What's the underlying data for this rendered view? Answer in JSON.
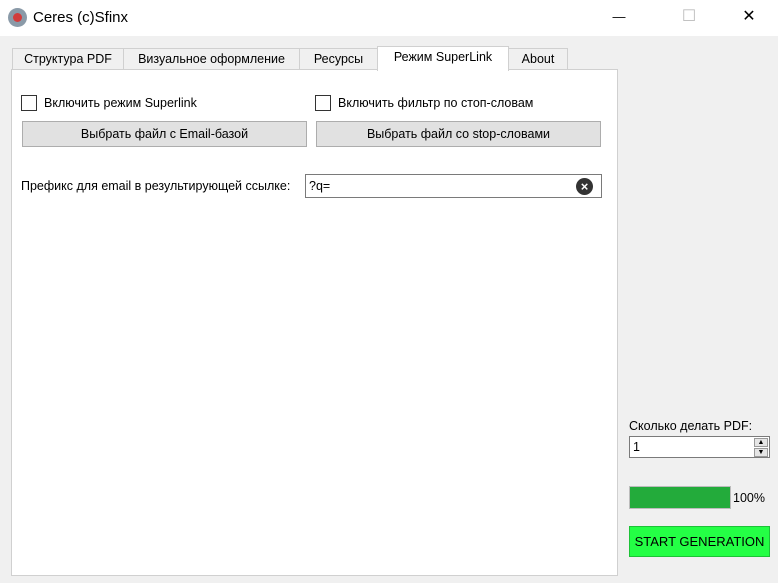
{
  "window": {
    "title": "Ceres (c)Sfinx",
    "minimize": "—",
    "maximize": "☐",
    "close": "✕"
  },
  "tabs": [
    {
      "label": "Структура PDF"
    },
    {
      "label": "Визуальное оформление"
    },
    {
      "label": "Ресурсы"
    },
    {
      "label": "Режим SuperLink"
    },
    {
      "label": "About"
    }
  ],
  "superlink": {
    "enable_superlink": "Включить режим Superlink",
    "enable_superlink_checked": false,
    "enable_filter": "Включить фильтр по стоп-словам",
    "enable_filter_checked": false,
    "choose_email_file": "Выбрать файл с Email-базой",
    "choose_stop_file": "Выбрать файл со stop-словами",
    "prefix_label": "Префикс для email в результирующей ссылке:",
    "prefix_value": "?q="
  },
  "side": {
    "count_label": "Сколько делать PDF:",
    "count_value": "1",
    "progress_percent": 100,
    "progress_text": "100%",
    "start_label": "START GENERATION"
  },
  "colors": {
    "progress": "#23ab3b",
    "start": "#24ff45"
  }
}
